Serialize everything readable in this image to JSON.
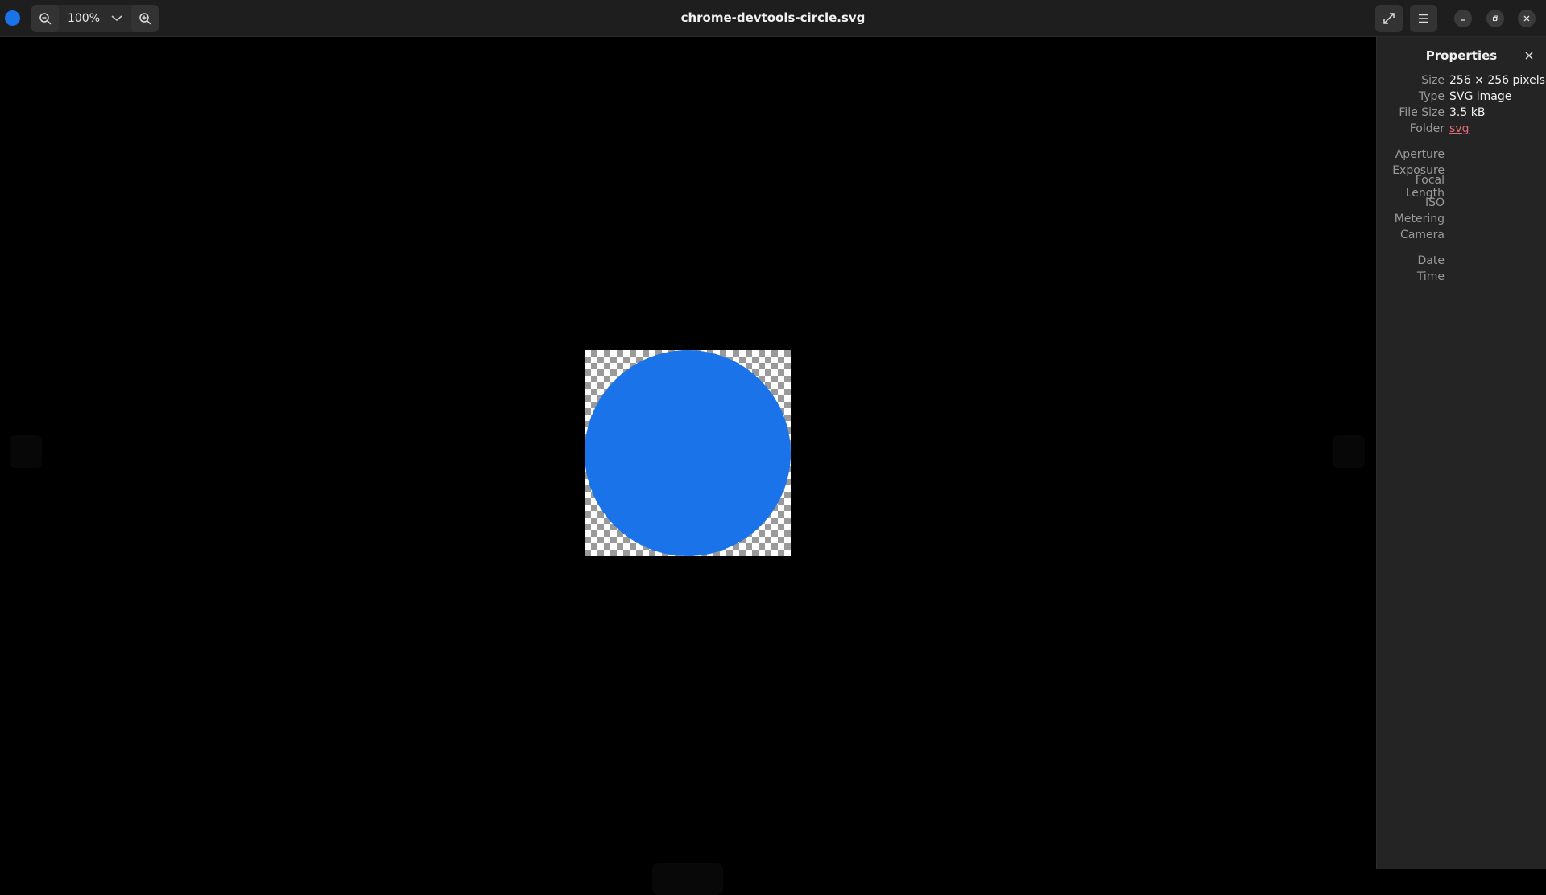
{
  "window": {
    "title": "chrome-devtools-circle.svg"
  },
  "toolbar": {
    "zoom_level": "100%",
    "icons": {
      "app": "app-icon",
      "zoom_out": "zoom-out-icon",
      "zoom_in": "zoom-in-icon",
      "zoom_dropdown": "chevron-down-icon",
      "fullscreen": "fullscreen-icon",
      "menu": "hamburger-menu-icon",
      "minimize": "minimize-icon",
      "maximize": "restore-icon",
      "close": "close-icon"
    }
  },
  "image": {
    "fill_color": "#1a73e8"
  },
  "properties": {
    "title": "Properties",
    "basic": [
      {
        "label": "Size",
        "value": "256 × 256 pixels"
      },
      {
        "label": "Type",
        "value": "SVG image"
      },
      {
        "label": "File Size",
        "value": "3.5 kB"
      },
      {
        "label": "Folder",
        "value": "svg"
      }
    ],
    "exif": [
      {
        "label": "Aperture",
        "value": ""
      },
      {
        "label": "Exposure",
        "value": ""
      },
      {
        "label": "Focal Length",
        "value": ""
      },
      {
        "label": "ISO",
        "value": ""
      },
      {
        "label": "Metering",
        "value": ""
      },
      {
        "label": "Camera",
        "value": ""
      }
    ],
    "datetime": [
      {
        "label": "Date",
        "value": ""
      },
      {
        "label": "Time",
        "value": ""
      }
    ]
  },
  "colors": {
    "accent": "#1a73e8",
    "link": "#e06c75",
    "panel_bg": "#242424",
    "titlebar_bg": "#1e1e1e"
  }
}
